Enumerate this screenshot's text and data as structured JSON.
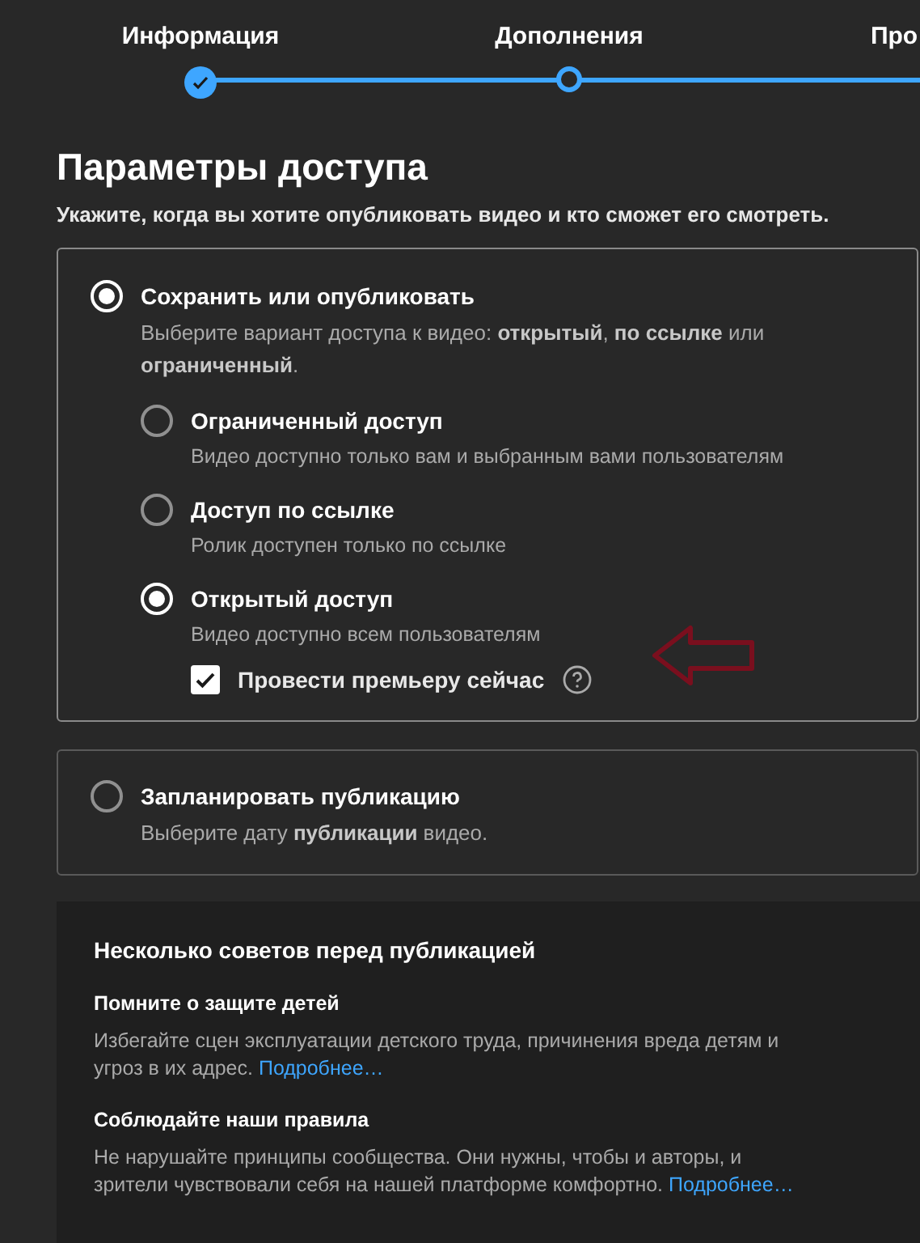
{
  "steps": [
    {
      "label": "Информация",
      "completed": true
    },
    {
      "label": "Дополнения",
      "completed": false
    },
    {
      "label": "Про"
    }
  ],
  "heading": "Параметры доступа",
  "subheading": "Укажите, когда вы хотите опубликовать видео и кто сможет его смотреть.",
  "publish_card": {
    "title": "Сохранить или опубликовать",
    "selected": true,
    "description": "Выберите вариант доступа к видео: **открытый**, **по ссылке** или **ограниченный**.",
    "options": [
      {
        "title": "Ограниченный доступ",
        "description": "Видео доступно только вам и выбранным вами пользователям",
        "selected": false
      },
      {
        "title": "Доступ по ссылке",
        "description": "Ролик доступен только по ссылке",
        "selected": false
      },
      {
        "title": "Открытый доступ",
        "description": "Видео доступно всем пользователям",
        "selected": true
      }
    ],
    "premiere": {
      "label": "Провести премьеру сейчас",
      "checked": true
    }
  },
  "schedule_card": {
    "title": "Запланировать публикацию",
    "selected": false,
    "description": "Выберите дату **публикации** видео."
  },
  "tips": {
    "title": "Несколько советов перед публикацией",
    "items": [
      {
        "heading": "Помните о защите детей",
        "text": "Избегайте сцен эксплуатации детского труда, причинения вреда детям и угроз в их адрес.",
        "link": "Подробнее…"
      },
      {
        "heading": "Соблюдайте наши правила",
        "text": "Не нарушайте принципы сообщества. Они нужны, чтобы и авторы, и зрители чувствовали себя на нашей платформе комфортно.",
        "link": "Подробнее…"
      }
    ]
  }
}
